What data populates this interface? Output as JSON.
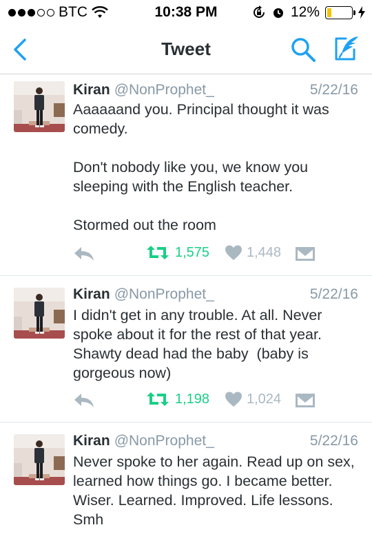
{
  "status_bar": {
    "carrier": "BTC",
    "time": "10:38 PM",
    "battery": "12%",
    "signal_bars": 5,
    "signal_filled": 3,
    "battery_level": 0.12
  },
  "nav": {
    "title": "Tweet",
    "accent": "#1da1f2"
  },
  "tweets": [
    {
      "name": "Kiran",
      "handle": "@NonProphet_",
      "date": "5/22/16",
      "text": "Aaaaaand you. Principal thought it was comedy.\n\nDon't nobody like you, we know you sleeping with the English teacher.\n\nStormed out the room",
      "retweets": "1,575",
      "likes": "1,448"
    },
    {
      "name": "Kiran",
      "handle": "@NonProphet_",
      "date": "5/22/16",
      "text": "I didn't get in any trouble. At all. Never spoke about it for the rest of that year. Shawty dead had the baby  (baby is gorgeous now)",
      "retweets": "1,198",
      "likes": "1,024"
    },
    {
      "name": "Kiran",
      "handle": "@NonProphet_",
      "date": "5/22/16",
      "text": "Never spoke to her again. Read up on sex, learned how things go. I became better. Wiser. Learned. Improved. Life lessons. Smh"
    }
  ]
}
